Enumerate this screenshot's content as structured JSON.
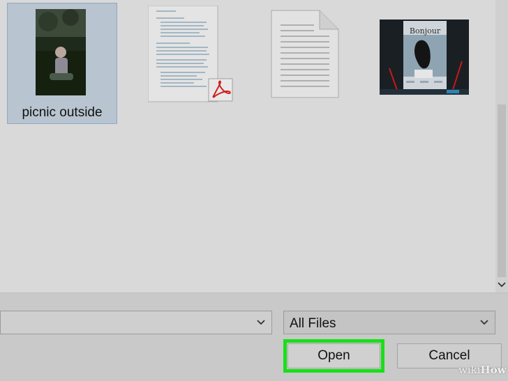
{
  "files": [
    {
      "name": "picnic outside",
      "type": "image",
      "selected": true
    },
    {
      "name": "",
      "type": "pdf",
      "selected": false
    },
    {
      "name": "",
      "type": "text",
      "selected": false
    },
    {
      "name": "",
      "type": "image",
      "selected": false,
      "thumb_text": "Bonjour"
    }
  ],
  "dialog": {
    "filename_value": "",
    "file_type_filter": "All Files",
    "open_label": "Open",
    "cancel_label": "Cancel"
  },
  "watermark": {
    "prefix": "wiki",
    "brand": "How"
  },
  "colors": {
    "highlight": "#18e018",
    "selection_bg": "#b8c4cf"
  },
  "icons": [
    "pdf-icon",
    "chevron-down-icon"
  ]
}
